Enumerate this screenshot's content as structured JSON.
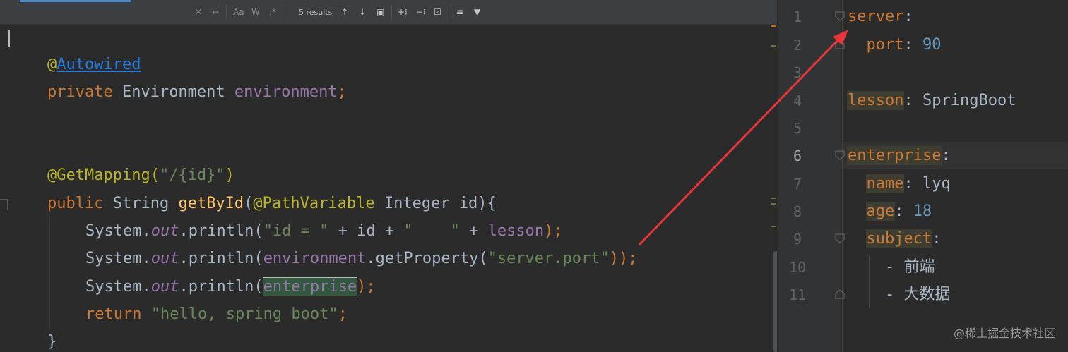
{
  "search_bar": {
    "results_text": "5 results",
    "icons": [
      "close-icon",
      "replace-icon",
      "match-case-icon",
      "words-icon",
      "regex-icon",
      "prev-occurrence-icon",
      "next-occurrence-icon",
      "select-all-icon",
      "add-selection-icon",
      "remove-selection-icon",
      "select-all-occurrences-icon",
      "filter-icon",
      "funnel-icon"
    ],
    "labels": {
      "match_case": "Aa",
      "words": "W",
      "regex": ".*"
    }
  },
  "java_editor": {
    "lines": [
      {
        "at": "@",
        "annotation": "Autowired"
      },
      {
        "keyword": "private",
        "type": " Environment ",
        "field": "environment",
        "end": ";"
      },
      {
        "annotation": "@GetMapping(",
        "string": "\"/{id}\"",
        "close": ")"
      },
      {
        "keyword": "public",
        "type": " String ",
        "method": "getById",
        "open": "(",
        "param_ann": "@PathVariable",
        "rest": " Integer id){"
      },
      {
        "prefix": "System.",
        "field": "out",
        "call": ".println(",
        "s1": "\"id = \"",
        "mid1": " + id + ",
        "s2": "\"    \"",
        "mid2": " + ",
        "field2": "lesson",
        "end": ");"
      },
      {
        "prefix": "System.",
        "field": "out",
        "call": ".println(",
        "field2": "environment",
        "call2": ".getProperty(",
        "s1": "\"server.port\"",
        "end": "));"
      },
      {
        "prefix": "System.",
        "field": "out",
        "call": ".println(",
        "field2": "enterprise",
        "end": ");"
      },
      {
        "keyword": "return",
        "space": " ",
        "string": "\"hello, spring boot\"",
        "end": ";"
      },
      {
        "brace": "}"
      }
    ]
  },
  "yaml_editor": {
    "line_numbers": [
      "1",
      "2",
      "3",
      "4",
      "5",
      "6",
      "7",
      "8",
      "9",
      "10",
      "11"
    ],
    "lines": [
      {
        "key": "server",
        "colon": ":"
      },
      {
        "indent": "  ",
        "key": "port",
        "colon": ": ",
        "num": "90"
      },
      {},
      {
        "key": "lesson",
        "colon": ": ",
        "value": "SpringBoot"
      },
      {},
      {
        "key": "enterprise",
        "colon": ":"
      },
      {
        "indent": "  ",
        "key": "name",
        "colon": ": ",
        "value": "lyq"
      },
      {
        "indent": "  ",
        "key": "age",
        "colon": ": ",
        "num": "18"
      },
      {
        "indent": "  ",
        "key": "subject",
        "colon": ":"
      },
      {
        "indent": "    ",
        "value": "- 前端"
      },
      {
        "indent": "    ",
        "value": "- 大数据"
      }
    ]
  },
  "watermark": "@稀土掘金技术社区",
  "colors": {
    "arrow": "#e8343a",
    "keyword": "#cc7832",
    "string": "#6a8759",
    "field": "#9876aa",
    "number": "#6897bb"
  }
}
